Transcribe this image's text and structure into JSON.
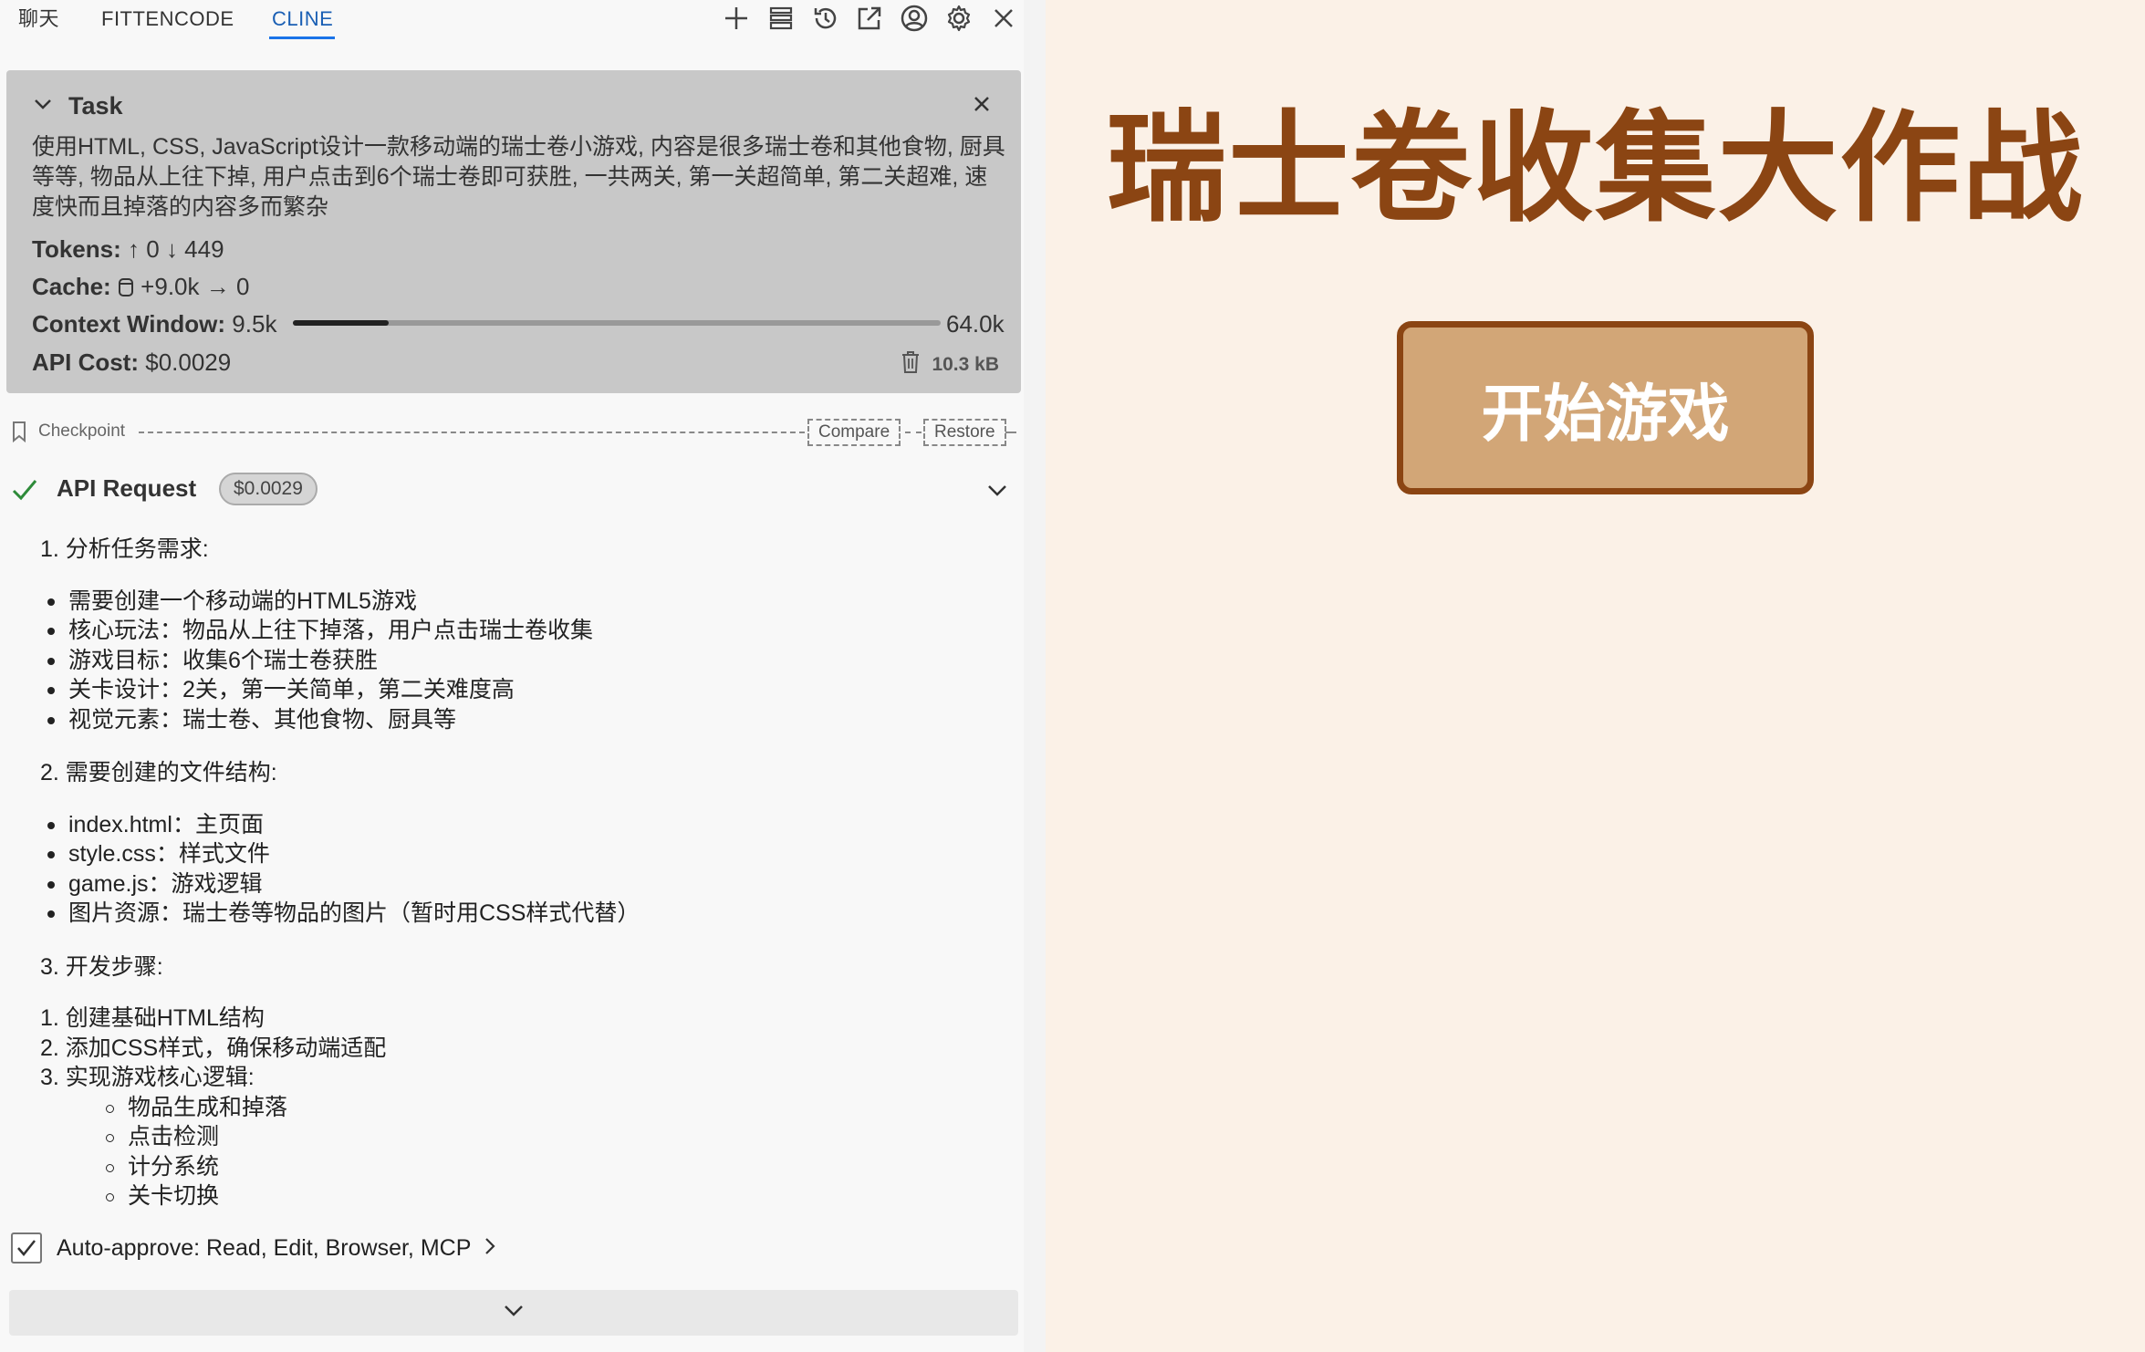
{
  "tabs": [
    {
      "label": "聊天",
      "active": false
    },
    {
      "label": "FITTENCODE",
      "active": false
    },
    {
      "label": "CLINE",
      "active": true
    }
  ],
  "toolbar_icons": [
    "plus-icon",
    "database-icon",
    "history-icon",
    "popout-icon",
    "account-icon",
    "gear-icon",
    "close-icon"
  ],
  "task": {
    "title": "Task",
    "text": "使用HTML, CSS, JavaScript设计一款移动端的瑞士卷小游戏, 内容是很多瑞士卷和其他食物, 厨具等等, 物品从上往下掉, 用户点击到6个瑞士卷即可获胜, 一共两关, 第一关超简单, 第二关超难, 速度快而且掉落的内容多而繁杂",
    "tokens_label": "Tokens:",
    "tokens_up": "0",
    "tokens_down": "449",
    "cache_label": "Cache:",
    "cache_write": "+9.0k",
    "cache_read": "0",
    "context_label": "Context Window:",
    "context_used": "9.5k",
    "context_max": "64.0k",
    "context_fraction": 0.148,
    "cost_label": "API Cost:",
    "cost_value": "$0.0029",
    "size": "10.3 kB"
  },
  "checkpoint": {
    "label": "Checkpoint",
    "compare": "Compare",
    "restore": "Restore"
  },
  "api_request": {
    "title": "API Request",
    "cost": "$0.0029"
  },
  "content": {
    "s1_title": "1. 分析任务需求:",
    "s1_items": [
      "需要创建一个移动端的HTML5游戏",
      "核心玩法：物品从上往下掉落，用户点击瑞士卷收集",
      "游戏目标：收集6个瑞士卷获胜",
      "关卡设计：2关，第一关简单，第二关难度高",
      "视觉元素：瑞士卷、其他食物、厨具等"
    ],
    "s2_title": "2. 需要创建的文件结构:",
    "s2_items": [
      "index.html：主页面",
      "style.css：样式文件",
      "game.js：游戏逻辑",
      "图片资源：瑞士卷等物品的图片（暂时用CSS样式代替）"
    ],
    "s3_title": "3. 开发步骤:",
    "s3_items": [
      "1. 创建基础HTML结构",
      "2. 添加CSS样式，确保移动端适配",
      "3. 实现游戏核心逻辑:"
    ],
    "s3_sub": [
      "物品生成和掉落",
      "点击检测",
      "计分系统",
      "关卡切换"
    ]
  },
  "auto_approve": {
    "label": "Auto-approve: Read, Edit, Browser, MCP",
    "checked": true
  },
  "game": {
    "title": "瑞士卷收集大作战",
    "start_button": "开始游戏",
    "title_color": "#8b4513",
    "button_color": "#d2a677",
    "background": "#fbf1e7"
  }
}
